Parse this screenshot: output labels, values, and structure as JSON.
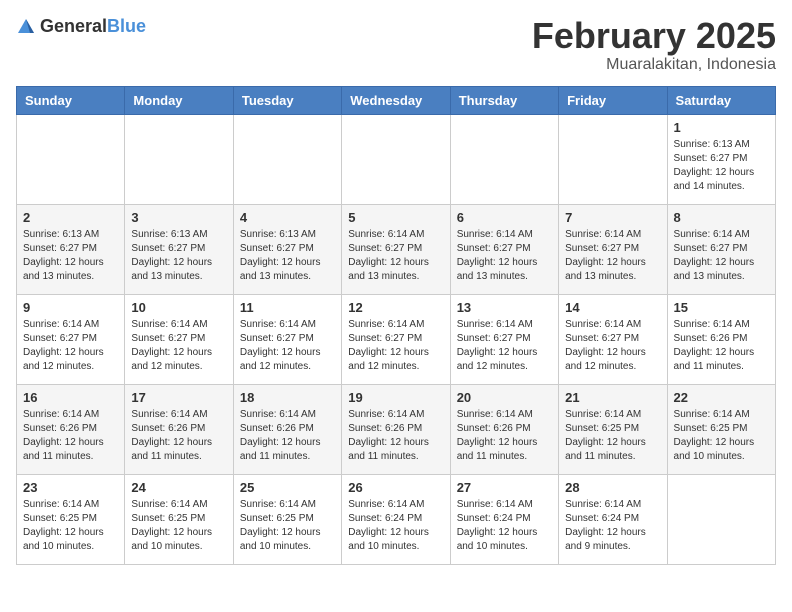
{
  "header": {
    "logo_general": "General",
    "logo_blue": "Blue",
    "month": "February 2025",
    "location": "Muaralakitan, Indonesia"
  },
  "weekdays": [
    "Sunday",
    "Monday",
    "Tuesday",
    "Wednesday",
    "Thursday",
    "Friday",
    "Saturday"
  ],
  "weeks": [
    [
      {
        "day": "",
        "info": ""
      },
      {
        "day": "",
        "info": ""
      },
      {
        "day": "",
        "info": ""
      },
      {
        "day": "",
        "info": ""
      },
      {
        "day": "",
        "info": ""
      },
      {
        "day": "",
        "info": ""
      },
      {
        "day": "1",
        "info": "Sunrise: 6:13 AM\nSunset: 6:27 PM\nDaylight: 12 hours\nand 14 minutes."
      }
    ],
    [
      {
        "day": "2",
        "info": "Sunrise: 6:13 AM\nSunset: 6:27 PM\nDaylight: 12 hours\nand 13 minutes."
      },
      {
        "day": "3",
        "info": "Sunrise: 6:13 AM\nSunset: 6:27 PM\nDaylight: 12 hours\nand 13 minutes."
      },
      {
        "day": "4",
        "info": "Sunrise: 6:13 AM\nSunset: 6:27 PM\nDaylight: 12 hours\nand 13 minutes."
      },
      {
        "day": "5",
        "info": "Sunrise: 6:14 AM\nSunset: 6:27 PM\nDaylight: 12 hours\nand 13 minutes."
      },
      {
        "day": "6",
        "info": "Sunrise: 6:14 AM\nSunset: 6:27 PM\nDaylight: 12 hours\nand 13 minutes."
      },
      {
        "day": "7",
        "info": "Sunrise: 6:14 AM\nSunset: 6:27 PM\nDaylight: 12 hours\nand 13 minutes."
      },
      {
        "day": "8",
        "info": "Sunrise: 6:14 AM\nSunset: 6:27 PM\nDaylight: 12 hours\nand 13 minutes."
      }
    ],
    [
      {
        "day": "9",
        "info": "Sunrise: 6:14 AM\nSunset: 6:27 PM\nDaylight: 12 hours\nand 12 minutes."
      },
      {
        "day": "10",
        "info": "Sunrise: 6:14 AM\nSunset: 6:27 PM\nDaylight: 12 hours\nand 12 minutes."
      },
      {
        "day": "11",
        "info": "Sunrise: 6:14 AM\nSunset: 6:27 PM\nDaylight: 12 hours\nand 12 minutes."
      },
      {
        "day": "12",
        "info": "Sunrise: 6:14 AM\nSunset: 6:27 PM\nDaylight: 12 hours\nand 12 minutes."
      },
      {
        "day": "13",
        "info": "Sunrise: 6:14 AM\nSunset: 6:27 PM\nDaylight: 12 hours\nand 12 minutes."
      },
      {
        "day": "14",
        "info": "Sunrise: 6:14 AM\nSunset: 6:27 PM\nDaylight: 12 hours\nand 12 minutes."
      },
      {
        "day": "15",
        "info": "Sunrise: 6:14 AM\nSunset: 6:26 PM\nDaylight: 12 hours\nand 11 minutes."
      }
    ],
    [
      {
        "day": "16",
        "info": "Sunrise: 6:14 AM\nSunset: 6:26 PM\nDaylight: 12 hours\nand 11 minutes."
      },
      {
        "day": "17",
        "info": "Sunrise: 6:14 AM\nSunset: 6:26 PM\nDaylight: 12 hours\nand 11 minutes."
      },
      {
        "day": "18",
        "info": "Sunrise: 6:14 AM\nSunset: 6:26 PM\nDaylight: 12 hours\nand 11 minutes."
      },
      {
        "day": "19",
        "info": "Sunrise: 6:14 AM\nSunset: 6:26 PM\nDaylight: 12 hours\nand 11 minutes."
      },
      {
        "day": "20",
        "info": "Sunrise: 6:14 AM\nSunset: 6:26 PM\nDaylight: 12 hours\nand 11 minutes."
      },
      {
        "day": "21",
        "info": "Sunrise: 6:14 AM\nSunset: 6:25 PM\nDaylight: 12 hours\nand 11 minutes."
      },
      {
        "day": "22",
        "info": "Sunrise: 6:14 AM\nSunset: 6:25 PM\nDaylight: 12 hours\nand 10 minutes."
      }
    ],
    [
      {
        "day": "23",
        "info": "Sunrise: 6:14 AM\nSunset: 6:25 PM\nDaylight: 12 hours\nand 10 minutes."
      },
      {
        "day": "24",
        "info": "Sunrise: 6:14 AM\nSunset: 6:25 PM\nDaylight: 12 hours\nand 10 minutes."
      },
      {
        "day": "25",
        "info": "Sunrise: 6:14 AM\nSunset: 6:25 PM\nDaylight: 12 hours\nand 10 minutes."
      },
      {
        "day": "26",
        "info": "Sunrise: 6:14 AM\nSunset: 6:24 PM\nDaylight: 12 hours\nand 10 minutes."
      },
      {
        "day": "27",
        "info": "Sunrise: 6:14 AM\nSunset: 6:24 PM\nDaylight: 12 hours\nand 10 minutes."
      },
      {
        "day": "28",
        "info": "Sunrise: 6:14 AM\nSunset: 6:24 PM\nDaylight: 12 hours\nand 9 minutes."
      },
      {
        "day": "",
        "info": ""
      }
    ]
  ]
}
